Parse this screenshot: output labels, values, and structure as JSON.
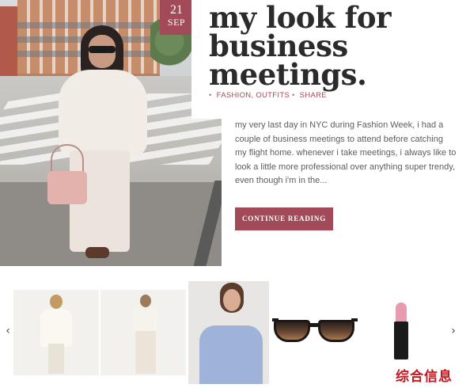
{
  "post": {
    "date_day": "21",
    "date_month": "SEP",
    "title": "my look for business meetings.",
    "meta": {
      "categories": "FASHION, OUTFITS",
      "share": "SHARE"
    },
    "excerpt": "my very last day in NYC during Fashion Week, i had a couple of business meetings to attend before catching my flight home. whenever i take meetings, i always like to look a little more professional over anything super trendy, even though i'm in the...",
    "read_more_label": "CONTINUE READING"
  },
  "carousel": {
    "prev_icon": "‹",
    "next_icon": "›",
    "items": [
      {
        "name": "model-white-top"
      },
      {
        "name": "model-white-pants"
      },
      {
        "name": "model-blue-blouse"
      },
      {
        "name": "sunglasses"
      },
      {
        "name": "pink-lipstick"
      }
    ]
  },
  "watermark": "综合信息",
  "colors": {
    "accent": "#a24a57",
    "text": "#5d5d5d",
    "title": "#2b2b2b"
  }
}
